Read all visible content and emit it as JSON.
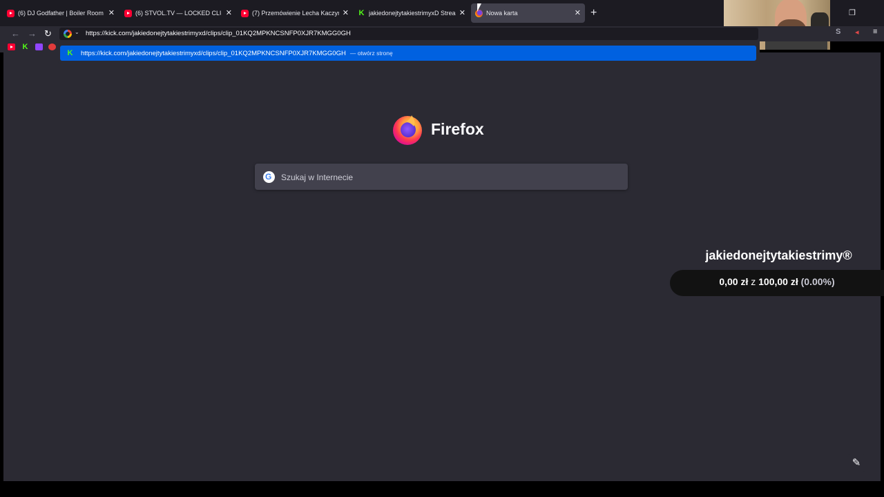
{
  "tabs": [
    {
      "title": "(6) DJ Godfather | Boiler Room",
      "favicon": "youtube-icon",
      "active": false
    },
    {
      "title": "(6) STVOL.TV — LOCKED CLUB",
      "favicon": "youtube-icon",
      "active": false
    },
    {
      "title": "(7) Przemówienie Lecha Kaczyń",
      "favicon": "youtube-icon",
      "active": false
    },
    {
      "title": "jakiedonejtytakiestrimyxD Strea",
      "favicon": "kick-icon",
      "active": false
    },
    {
      "title": "Nowa karta",
      "favicon": "firefox-icon",
      "active": true
    }
  ],
  "urlbar": {
    "value": "https://kick.com/jakiedonejtytakiestrimyxd/clips/clip_01KQ2MPKNCSNFP0XJR7KMGG0GH"
  },
  "suggestion": {
    "url": "https://kick.com/jakiedonejtytakiestrimyxd/clips/clip_01KQ2MPKNCSNFP0XJR7KMGG0GH",
    "action": "— otwórz stronę"
  },
  "newtab": {
    "brand": "Firefox",
    "search_placeholder": "Szukaj w Internecie"
  },
  "overlay": {
    "channel": "jakiedonejtytakiestrimy®",
    "goal_amount": "0,00 zł",
    "goal_sep": "z",
    "goal_target": "100,00 zł",
    "goal_percent": "(0.00%)"
  },
  "icons": {
    "youtube_color": "#ff0033",
    "kick_color": "#53fc18",
    "accent": "#0061e0"
  }
}
